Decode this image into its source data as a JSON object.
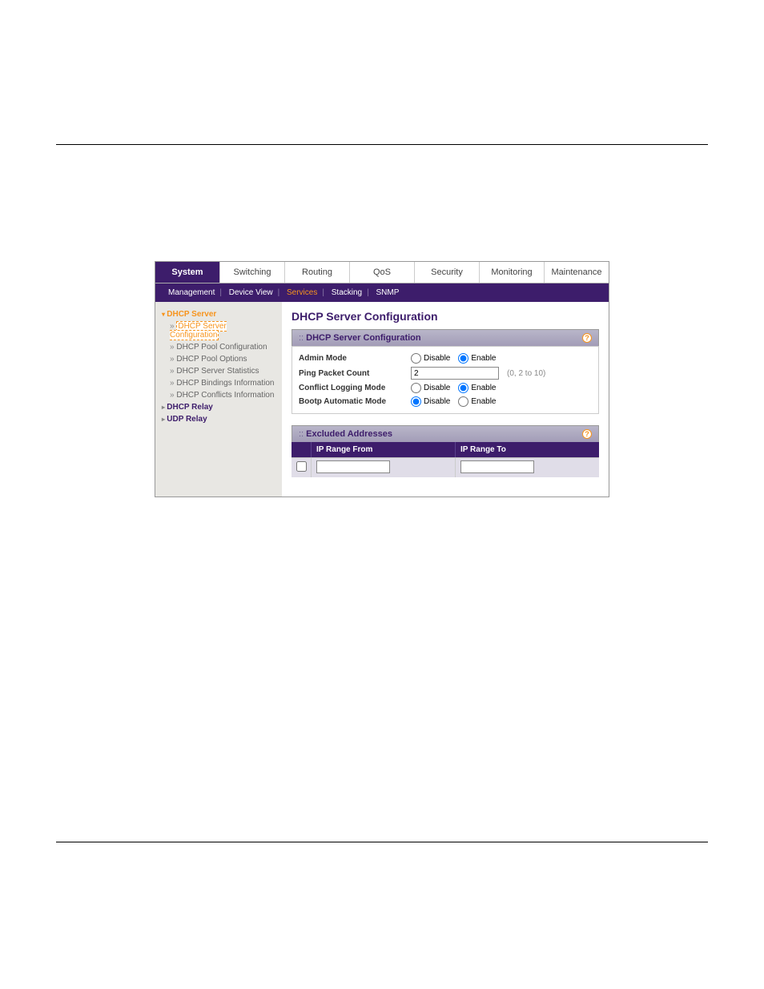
{
  "tabs": [
    "System",
    "Switching",
    "Routing",
    "QoS",
    "Security",
    "Monitoring",
    "Maintenance"
  ],
  "active_tab": 0,
  "subtabs": [
    "Management",
    "Device View",
    "Services",
    "Stacking",
    "SNMP"
  ],
  "active_subtab": 2,
  "sidebar": {
    "groups": [
      {
        "label": "DHCP Server",
        "expanded": true,
        "items": [
          {
            "label": "DHCP Server Configuration",
            "active": true
          },
          {
            "label": "DHCP Pool Configuration"
          },
          {
            "label": "DHCP Pool Options"
          },
          {
            "label": "DHCP Server Statistics"
          },
          {
            "label": "DHCP Bindings Information"
          },
          {
            "label": "DHCP Conflicts Information"
          }
        ]
      },
      {
        "label": "DHCP Relay",
        "expanded": false,
        "items": []
      },
      {
        "label": "UDP Relay",
        "expanded": false,
        "items": []
      }
    ]
  },
  "page_title": "DHCP Server Configuration",
  "panel1": {
    "title": "DHCP Server Configuration",
    "rows": {
      "admin_mode": {
        "label": "Admin Mode",
        "disable": "Disable",
        "enable": "Enable",
        "value": "Enable"
      },
      "ping_packet_count": {
        "label": "Ping Packet Count",
        "value": "2",
        "hint": "(0, 2 to 10)"
      },
      "conflict_logging_mode": {
        "label": "Conflict Logging Mode",
        "disable": "Disable",
        "enable": "Enable",
        "value": "Enable"
      },
      "bootp_automatic_mode": {
        "label": "Bootp Automatic Mode",
        "disable": "Disable",
        "enable": "Enable",
        "value": "Disable"
      }
    }
  },
  "panel2": {
    "title": "Excluded Addresses",
    "columns": [
      "IP Range From",
      "IP Range To"
    ],
    "rows": [
      {
        "from": "",
        "to": ""
      }
    ]
  }
}
